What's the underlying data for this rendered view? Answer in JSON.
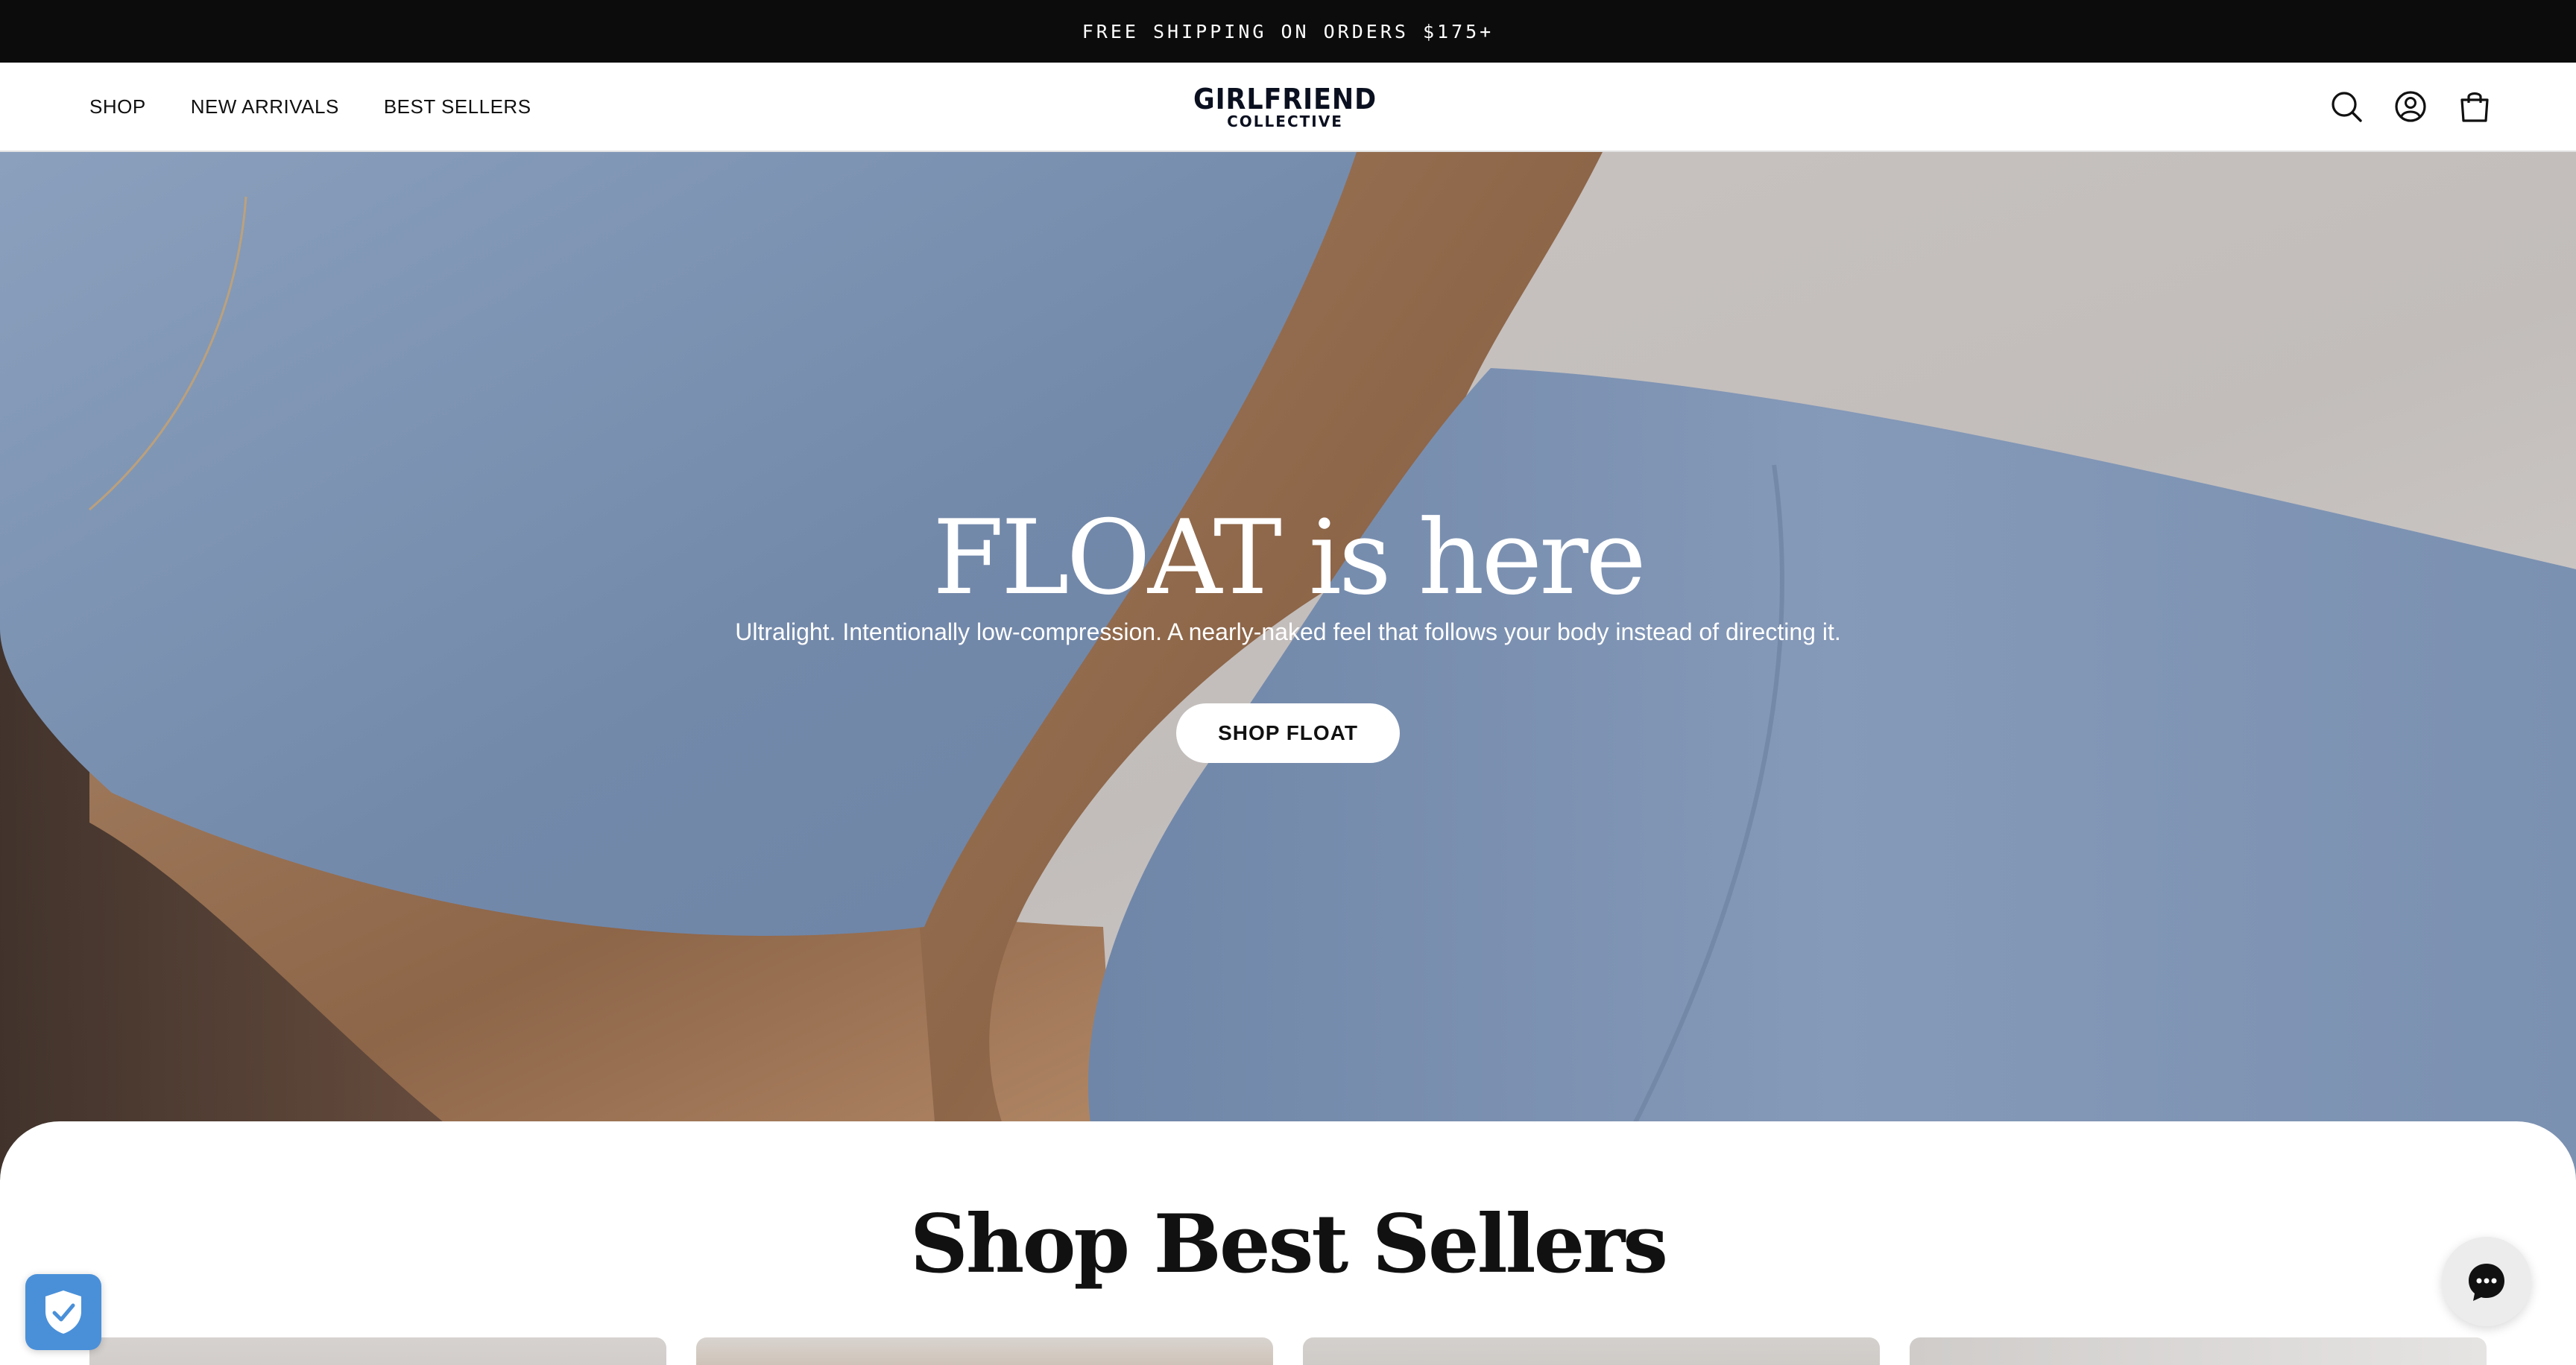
{
  "announcement": {
    "text": "FREE SHIPPING ON ORDERS $175+"
  },
  "nav": {
    "items": [
      "SHOP",
      "NEW ARRIVALS",
      "BEST SELLERS"
    ]
  },
  "logo": {
    "line1": "GIRLFRIEND",
    "line2": "COLLECTIVE"
  },
  "header_icons": [
    "search-icon",
    "account-icon",
    "cart-icon"
  ],
  "hero": {
    "title": "FLOAT is here",
    "subtitle": "Ultralight. Intentionally low-compression. A nearly-naked feel that follows your body instead of directing it.",
    "cta": "SHOP FLOAT"
  },
  "best_sellers": {
    "title": "Shop Best Sellers"
  },
  "widgets": [
    "shield-icon",
    "chat-icon"
  ],
  "colors": {
    "announcement_bg": "#0c0c0c",
    "fabric_blue": "#7d93b2",
    "shield_blue": "#4a90d9"
  }
}
